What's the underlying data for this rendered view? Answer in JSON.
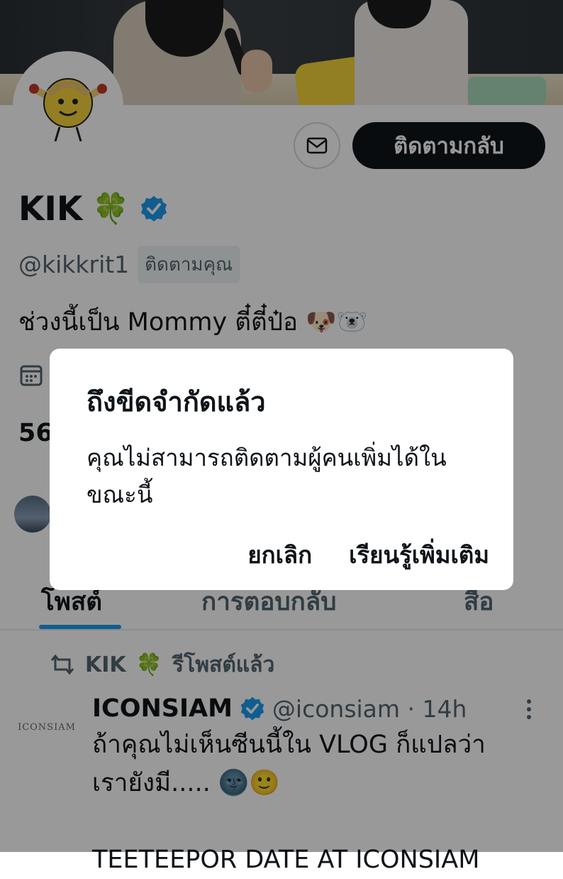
{
  "profile": {
    "follow_back_label": "ติดตามกลับ",
    "name": "KIK",
    "name_emoji": "🍀",
    "handle": "@kikkrit1",
    "follows_you": "ติดตามคุณ",
    "bio": "ช่วงนี้เป็น Mommy ตี๋ตี๋ป๋อ 🐶🐻‍❄️",
    "stat_partial": "56"
  },
  "tabs": [
    {
      "label": "โพสต์"
    },
    {
      "label": "การตอบกลับ"
    },
    {
      "label": "สื่อ"
    }
  ],
  "tweet": {
    "repost_user": "KIK",
    "repost_emoji": "🍀",
    "repost_label": "รีโพสต์แล้ว",
    "avatar_text": "ICONSIAM",
    "author_name": "ICONSIAM",
    "author_handle": "@iconsiam · 14h",
    "text": "ถ้าคุณไม่เห็นซีนนี้ใน VLOG ก็แปลว่า\nเรายังมี..... 🌚🙂\n\nTEETEEPOR DATE AT ICONSIAM"
  },
  "dialog": {
    "title": "ถึงขีดจำกัดแล้ว",
    "body": "คุณไม่สามารถติดตามผู้คนเพิ่มได้ในขณะนี้",
    "cancel_label": "ยกเลิก",
    "learn_more_label": "เรียนรู้เพิ่มเติม"
  },
  "colors": {
    "accent": "#1d9bf0",
    "text_primary": "#0f1419",
    "text_secondary": "#536471",
    "overlay": "rgba(0,0,0,0.4)"
  },
  "icons": {
    "message": "envelope-icon",
    "verified": "verified-badge-icon",
    "calendar": "calendar-icon",
    "repost": "repost-icon",
    "more": "more-vertical-icon"
  }
}
